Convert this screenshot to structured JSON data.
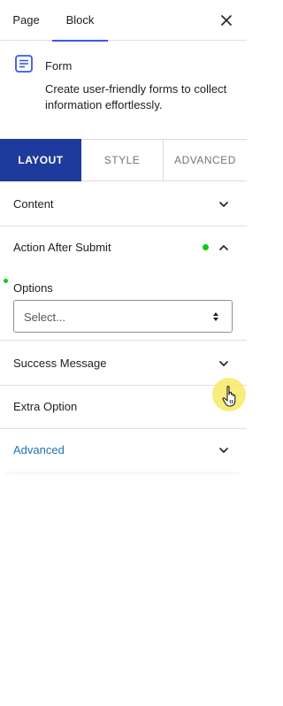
{
  "header": {
    "tabs": [
      {
        "label": "Page"
      },
      {
        "label": "Block"
      }
    ],
    "close_icon": "close-icon"
  },
  "block": {
    "icon": "form-icon",
    "title": "Form",
    "description": "Create user-friendly forms to collect information effortlessly."
  },
  "panel_tabs": [
    {
      "label": "LAYOUT"
    },
    {
      "label": "STYLE"
    },
    {
      "label": "ADVANCED"
    }
  ],
  "sections": {
    "content": {
      "title": "Content"
    },
    "action_after_submit": {
      "title": "Action After Submit",
      "options_label": "Options",
      "select_value": "Select..."
    },
    "success_message": {
      "title": "Success Message"
    },
    "extra_option": {
      "title": "Extra Option"
    },
    "advanced": {
      "title": "Advanced"
    }
  },
  "colors": {
    "accent": "#1e3a9c",
    "active_tab_underline": "#3858e9",
    "status_dot": "#13c913",
    "link_blue": "#2271b1"
  }
}
